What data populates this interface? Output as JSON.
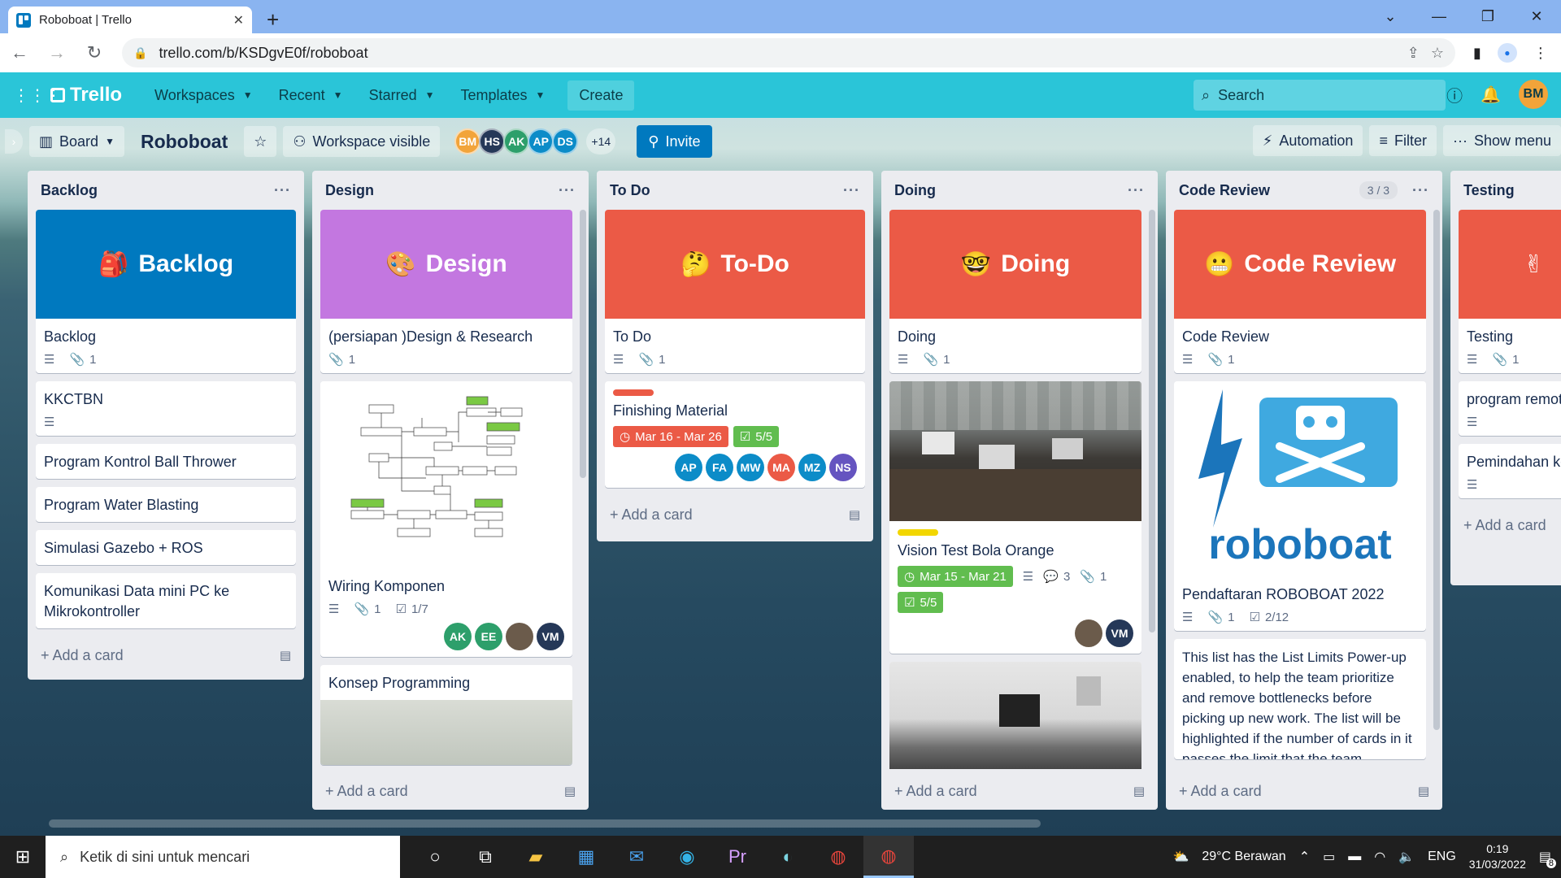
{
  "browser": {
    "tab_title": "Roboboat | Trello",
    "url": "trello.com/b/KSDgvE0f/roboboat"
  },
  "header": {
    "logo": "Trello",
    "menus": [
      "Workspaces",
      "Recent",
      "Starred",
      "Templates"
    ],
    "create": "Create",
    "search_placeholder": "Search",
    "user_initials": "BM"
  },
  "board": {
    "view": "Board",
    "name": "Roboboat",
    "visibility": "Workspace visible",
    "members": [
      {
        "i": "BM",
        "c": "#f2a43a"
      },
      {
        "i": "HS",
        "c": "#253858"
      },
      {
        "i": "AK",
        "c": "#2d9f6b"
      },
      {
        "i": "AP",
        "c": "#0c8cc8"
      },
      {
        "i": "DS",
        "c": "#0c8cc8"
      }
    ],
    "more_members": "+14",
    "invite": "Invite",
    "automation": "Automation",
    "filter": "Filter",
    "show_menu": "Show menu"
  },
  "lists": [
    {
      "title": "Backlog",
      "add": "Add a card",
      "cover_title": "Backlog",
      "cover_emoji": "🎒",
      "cover_color": "#0079bf",
      "cards": [
        {
          "title": "Backlog",
          "attach": "1"
        },
        {
          "title": "KKCTBN"
        },
        {
          "title": "Program Kontrol Ball Thrower"
        },
        {
          "title": "Program Water Blasting"
        },
        {
          "title": "Simulasi Gazebo + ROS"
        },
        {
          "title": "Komunikasi Data mini PC ke Mikrokontroller"
        }
      ]
    },
    {
      "title": "Design",
      "add": "Add a card",
      "cover_title": "Design",
      "cover_emoji": "🎨",
      "cover_color": "#c377e0",
      "cards": [
        {
          "title": "(persiapan )Design & Research",
          "attach": "1"
        },
        {
          "title": "Wiring Komponen",
          "attach": "1",
          "check": "1/7",
          "members": [
            "AK",
            "EE",
            "",
            "VM"
          ]
        },
        {
          "title": "Konsep Programming"
        }
      ]
    },
    {
      "title": "To Do",
      "add": "Add a card",
      "cover_title": "To-Do",
      "cover_emoji": "🤔",
      "cover_color": "#eb5a46",
      "cards": [
        {
          "title": "To Do",
          "attach": "1"
        },
        {
          "title": "Finishing Material",
          "date": "Mar 16 - Mar 26",
          "check": "5/5",
          "members": [
            "AP",
            "FA",
            "MW",
            "MA",
            "MZ",
            "NS"
          ]
        }
      ]
    },
    {
      "title": "Doing",
      "add": "Add a card",
      "cover_title": "Doing",
      "cover_emoji": "🤓",
      "cover_color": "#eb5a46",
      "cards": [
        {
          "title": "Doing",
          "attach": "1"
        },
        {
          "title": "Vision Test Bola Orange",
          "date": "Mar 15 - Mar 21",
          "comments": "3",
          "attach": "1",
          "check": "5/5",
          "members": [
            "",
            "VM"
          ]
        }
      ]
    },
    {
      "title": "Code Review",
      "limit": "3 / 3",
      "add": "Add a card",
      "cover_title": "Code Review",
      "cover_emoji": "😬",
      "cover_color": "#eb5a46",
      "cards": [
        {
          "title": "Code Review",
          "attach": "1"
        },
        {
          "title": "Pendaftaran ROBOBOAT 2022",
          "attach": "1",
          "check": "2/12",
          "logo_text": "roboboat"
        },
        {
          "desc": "This list has the List Limits Power-up enabled, to help the team prioritize and remove bottlenecks before picking up new work. The list will be highlighted if the number of cards in it passes the limit that the team"
        }
      ]
    },
    {
      "title": "Testing",
      "add": "Add a card",
      "cover_emoji": "✌",
      "cover_color": "#eb5a46",
      "cards": [
        {
          "title": "Testing",
          "attach": "1"
        },
        {
          "title": "program remote"
        },
        {
          "title": "Pemindahan komponen KAPAL"
        }
      ]
    }
  ],
  "taskbar": {
    "search": "Ketik di sini untuk mencari",
    "weather": "29°C  Berawan",
    "lang": "ENG",
    "time": "0:19",
    "date": "31/03/2022",
    "notif": "8"
  }
}
